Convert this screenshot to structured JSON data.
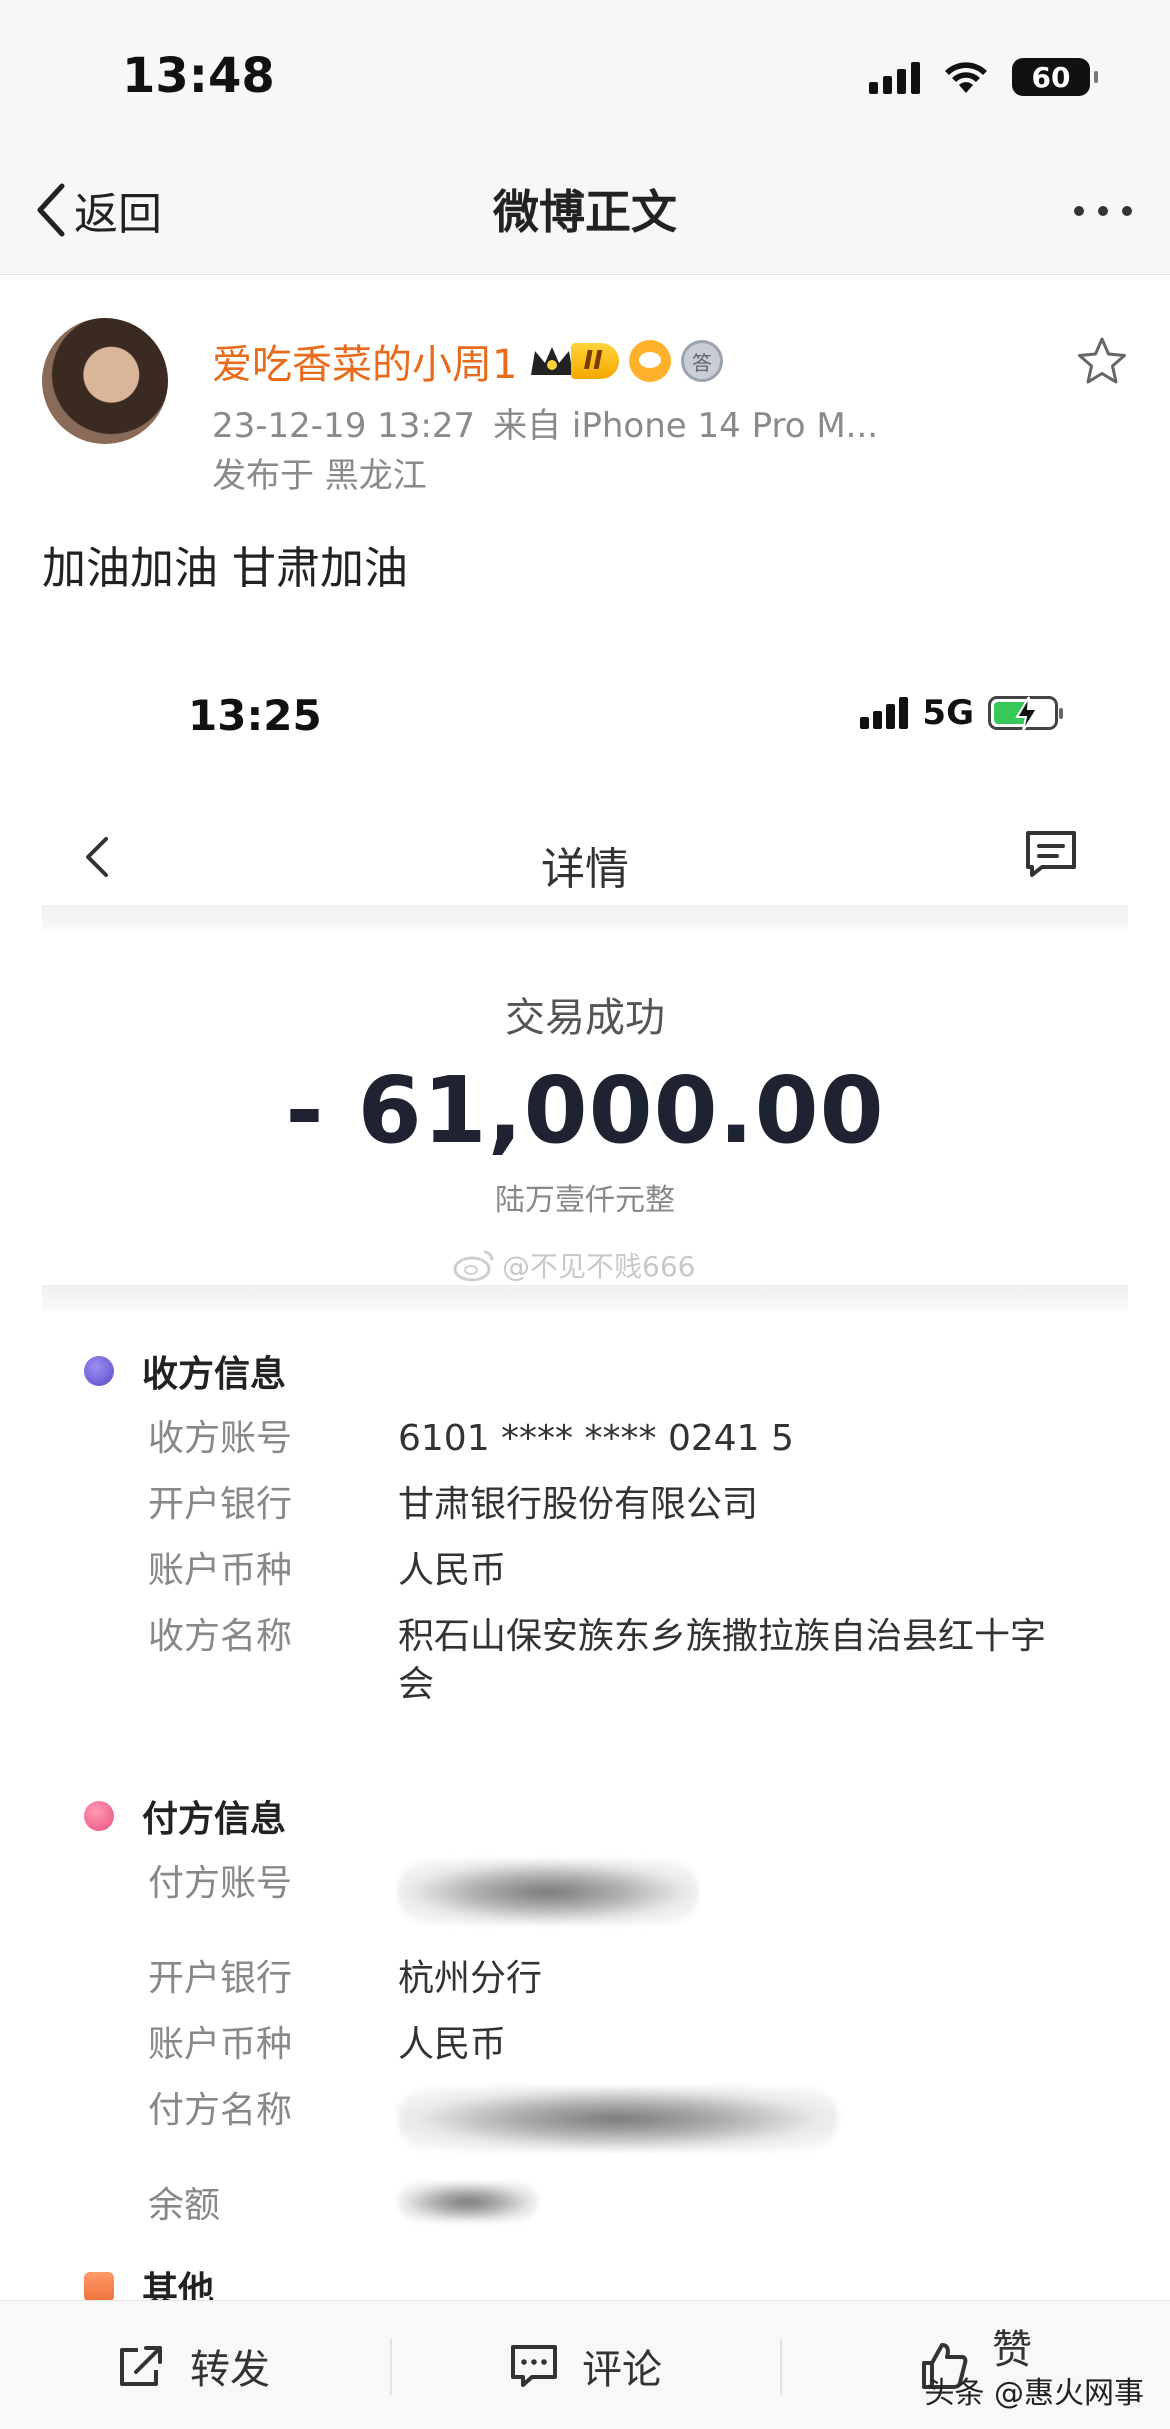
{
  "os_status": {
    "time": "13:48",
    "battery": "60"
  },
  "nav": {
    "back_label": "返回",
    "title": "微博正文"
  },
  "post": {
    "username": "爱吃香菜的小周1",
    "vip_level": "II",
    "medal": "答",
    "timestamp": "23-12-19 13:27",
    "source": "来自 iPhone 14 Pro M...",
    "location": "发布于 黑龙江",
    "text": "加油加油 甘肃加油"
  },
  "screenshot": {
    "status": {
      "time": "13:25",
      "network": "5G"
    },
    "nav_title": "详情",
    "tx_status": "交易成功",
    "amount": "- 61,000.00",
    "amount_words": "陆万壹仟元整",
    "watermark": "@不见不贱666",
    "payee": {
      "title": "收方信息",
      "rows": [
        {
          "label": "收方账号",
          "value": "6101 **** **** 0241 5"
        },
        {
          "label": "开户银行",
          "value": "甘肃银行股份有限公司"
        },
        {
          "label": "账户币种",
          "value": "人民币"
        },
        {
          "label": "收方名称",
          "value": "积石山保安族东乡族撒拉族自治县红十字会"
        }
      ]
    },
    "payer": {
      "title": "付方信息",
      "rows": [
        {
          "label": "付方账号",
          "value": ""
        },
        {
          "label": "开户银行",
          "value": "杭州分行"
        },
        {
          "label": "账户币种",
          "value": "人民币"
        },
        {
          "label": "付方名称",
          "value": ""
        },
        {
          "label": "余额",
          "value": ""
        }
      ]
    },
    "other": {
      "title": "其他"
    }
  },
  "actions": {
    "repost": "转发",
    "comment": "评论",
    "like": "赞"
  },
  "credit": {
    "text": "头条 @惠火网事"
  },
  "colors": {
    "username": "#e86b1c",
    "payee_dot": "#6a5bd6",
    "payer_dot": "#e8507a",
    "other_dot": "#f07a4a",
    "amount": "#1f2230"
  }
}
